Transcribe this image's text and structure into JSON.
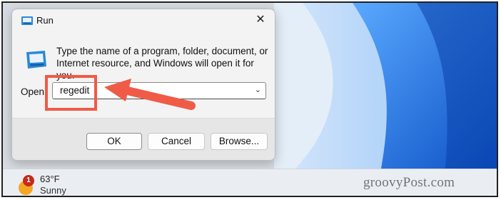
{
  "window": {
    "title": "Run",
    "close_glyph": "✕",
    "description": "Type the name of a program, folder, document, or Internet resource, and Windows will open it for you.",
    "open_label": "Open:",
    "open_value": "regedit",
    "dropdown_glyph": "⌄",
    "buttons": {
      "ok": "OK",
      "cancel": "Cancel",
      "browse": "Browse..."
    }
  },
  "taskbar": {
    "weather": {
      "badge": "1",
      "temperature": "63°F",
      "condition": "Sunny"
    }
  },
  "watermark": "groovyPost.com",
  "icons": [
    "run-icon",
    "close-icon",
    "chevron-down-icon",
    "weather-sun-icon"
  ],
  "colors": {
    "annotation": "#ef5b47",
    "desktop_accent": "#1a6fd6"
  }
}
